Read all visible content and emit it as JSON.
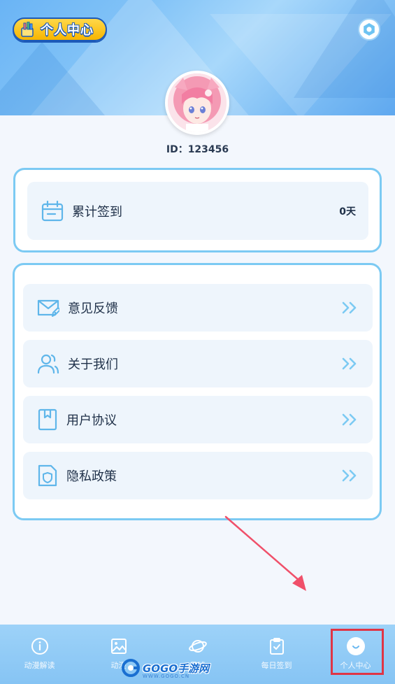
{
  "header": {
    "title": "个人中心"
  },
  "profile": {
    "id_label": "ID：123456"
  },
  "sign_card": {
    "label": "累计签到",
    "value": "0天"
  },
  "menu": {
    "items": [
      {
        "label": "意见反馈",
        "icon": "mail-edit-icon"
      },
      {
        "label": "关于我们",
        "icon": "users-icon"
      },
      {
        "label": "用户协议",
        "icon": "bookmark-doc-icon"
      },
      {
        "label": "隐私政策",
        "icon": "shield-doc-icon"
      }
    ]
  },
  "tabbar": {
    "items": [
      {
        "label": "动漫解读",
        "icon": "info-circle-icon"
      },
      {
        "label": "动漫",
        "icon": "image-icon"
      },
      {
        "label": "星球",
        "icon": "planet-icon"
      },
      {
        "label": "每日签到",
        "icon": "clipboard-check-icon"
      },
      {
        "label": "个人中心",
        "icon": "smile-icon",
        "active": true
      }
    ]
  },
  "watermark": {
    "text": "GOGO手游网",
    "sub": "WWW.GOGO.CN"
  },
  "colors": {
    "accent": "#7ccaf3",
    "badge": "#f7b500",
    "highlight": "#e03545",
    "tabbar": "#8fc9f5"
  }
}
